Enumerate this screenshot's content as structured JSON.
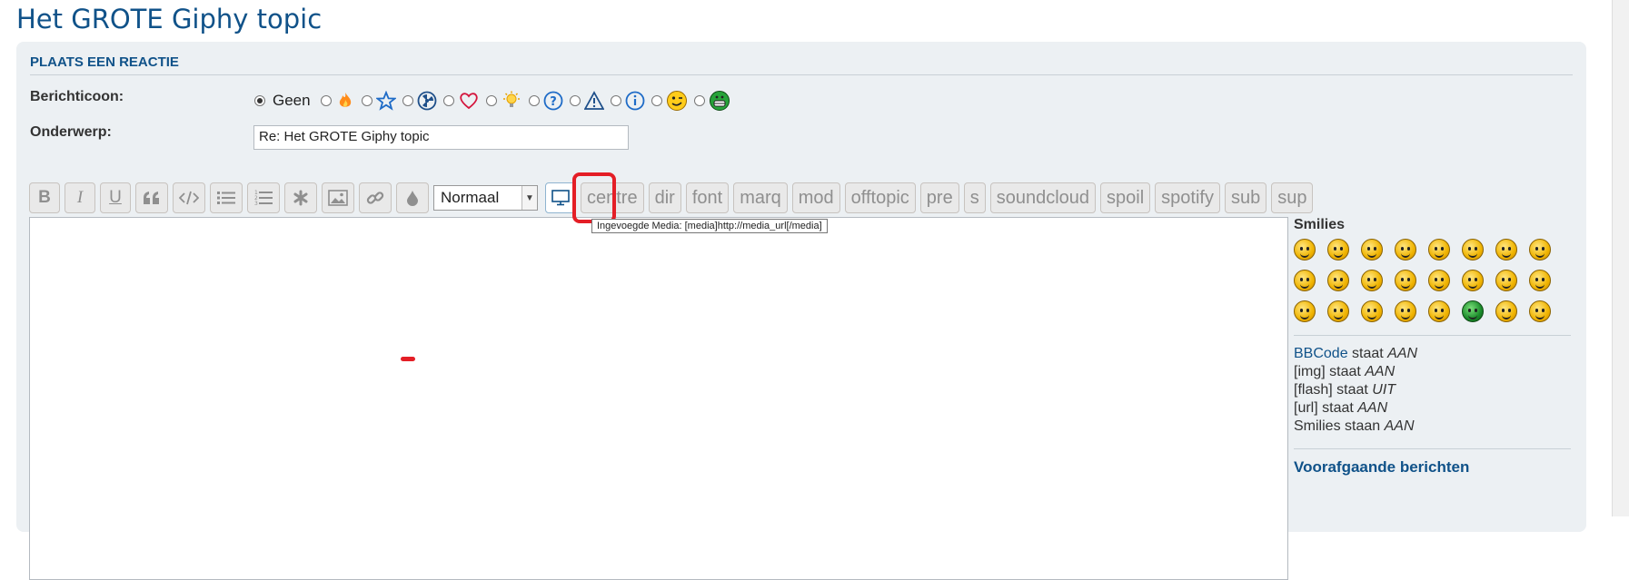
{
  "page": {
    "title": "Het GROTE Giphy topic"
  },
  "panel": {
    "title": "PLAATS EEN REACTIE"
  },
  "form": {
    "icon_label": "Berichticoon:",
    "icon_none_label": "Geen",
    "icon_options": [
      "fire-icon",
      "star-icon",
      "radioactive-icon",
      "heart-icon",
      "lightbulb-icon",
      "question-icon",
      "warning-icon",
      "info-icon",
      "wink-smiley-icon",
      "grin-smiley-icon"
    ],
    "subject_label": "Onderwerp:",
    "subject_value": "Re: Het GROTE Giphy topic"
  },
  "toolbar": {
    "bold": "B",
    "italic": "I",
    "underline": "U",
    "font_size_selected": "Normaal",
    "custom_buttons": [
      "centre",
      "dir",
      "font",
      "marq",
      "mod",
      "offtopic",
      "pre",
      "s",
      "soundcloud",
      "spoil",
      "spotify",
      "sub",
      "sup"
    ],
    "media_tooltip": "Ingevoegde Media: [media]http://media_url[/media]"
  },
  "sidebar": {
    "smilies_title": "Smilies",
    "smilies_count": 24,
    "bbcode_link": "BBCode",
    "bbcode_rest": " staat ",
    "bbcode_state": "AAN",
    "img_label": "[img] staat ",
    "img_state": "AAN",
    "flash_label": "[flash] staat ",
    "flash_state": "UIT",
    "url_label": "[url] staat ",
    "url_state": "AAN",
    "smilies_label": "Smilies staan ",
    "smilies_state": "AAN",
    "previous_posts": "Voorafgaande berichten"
  },
  "colors": {
    "accent": "#105289",
    "panel_bg": "#ECF0F3",
    "highlight": "#e41e26"
  }
}
